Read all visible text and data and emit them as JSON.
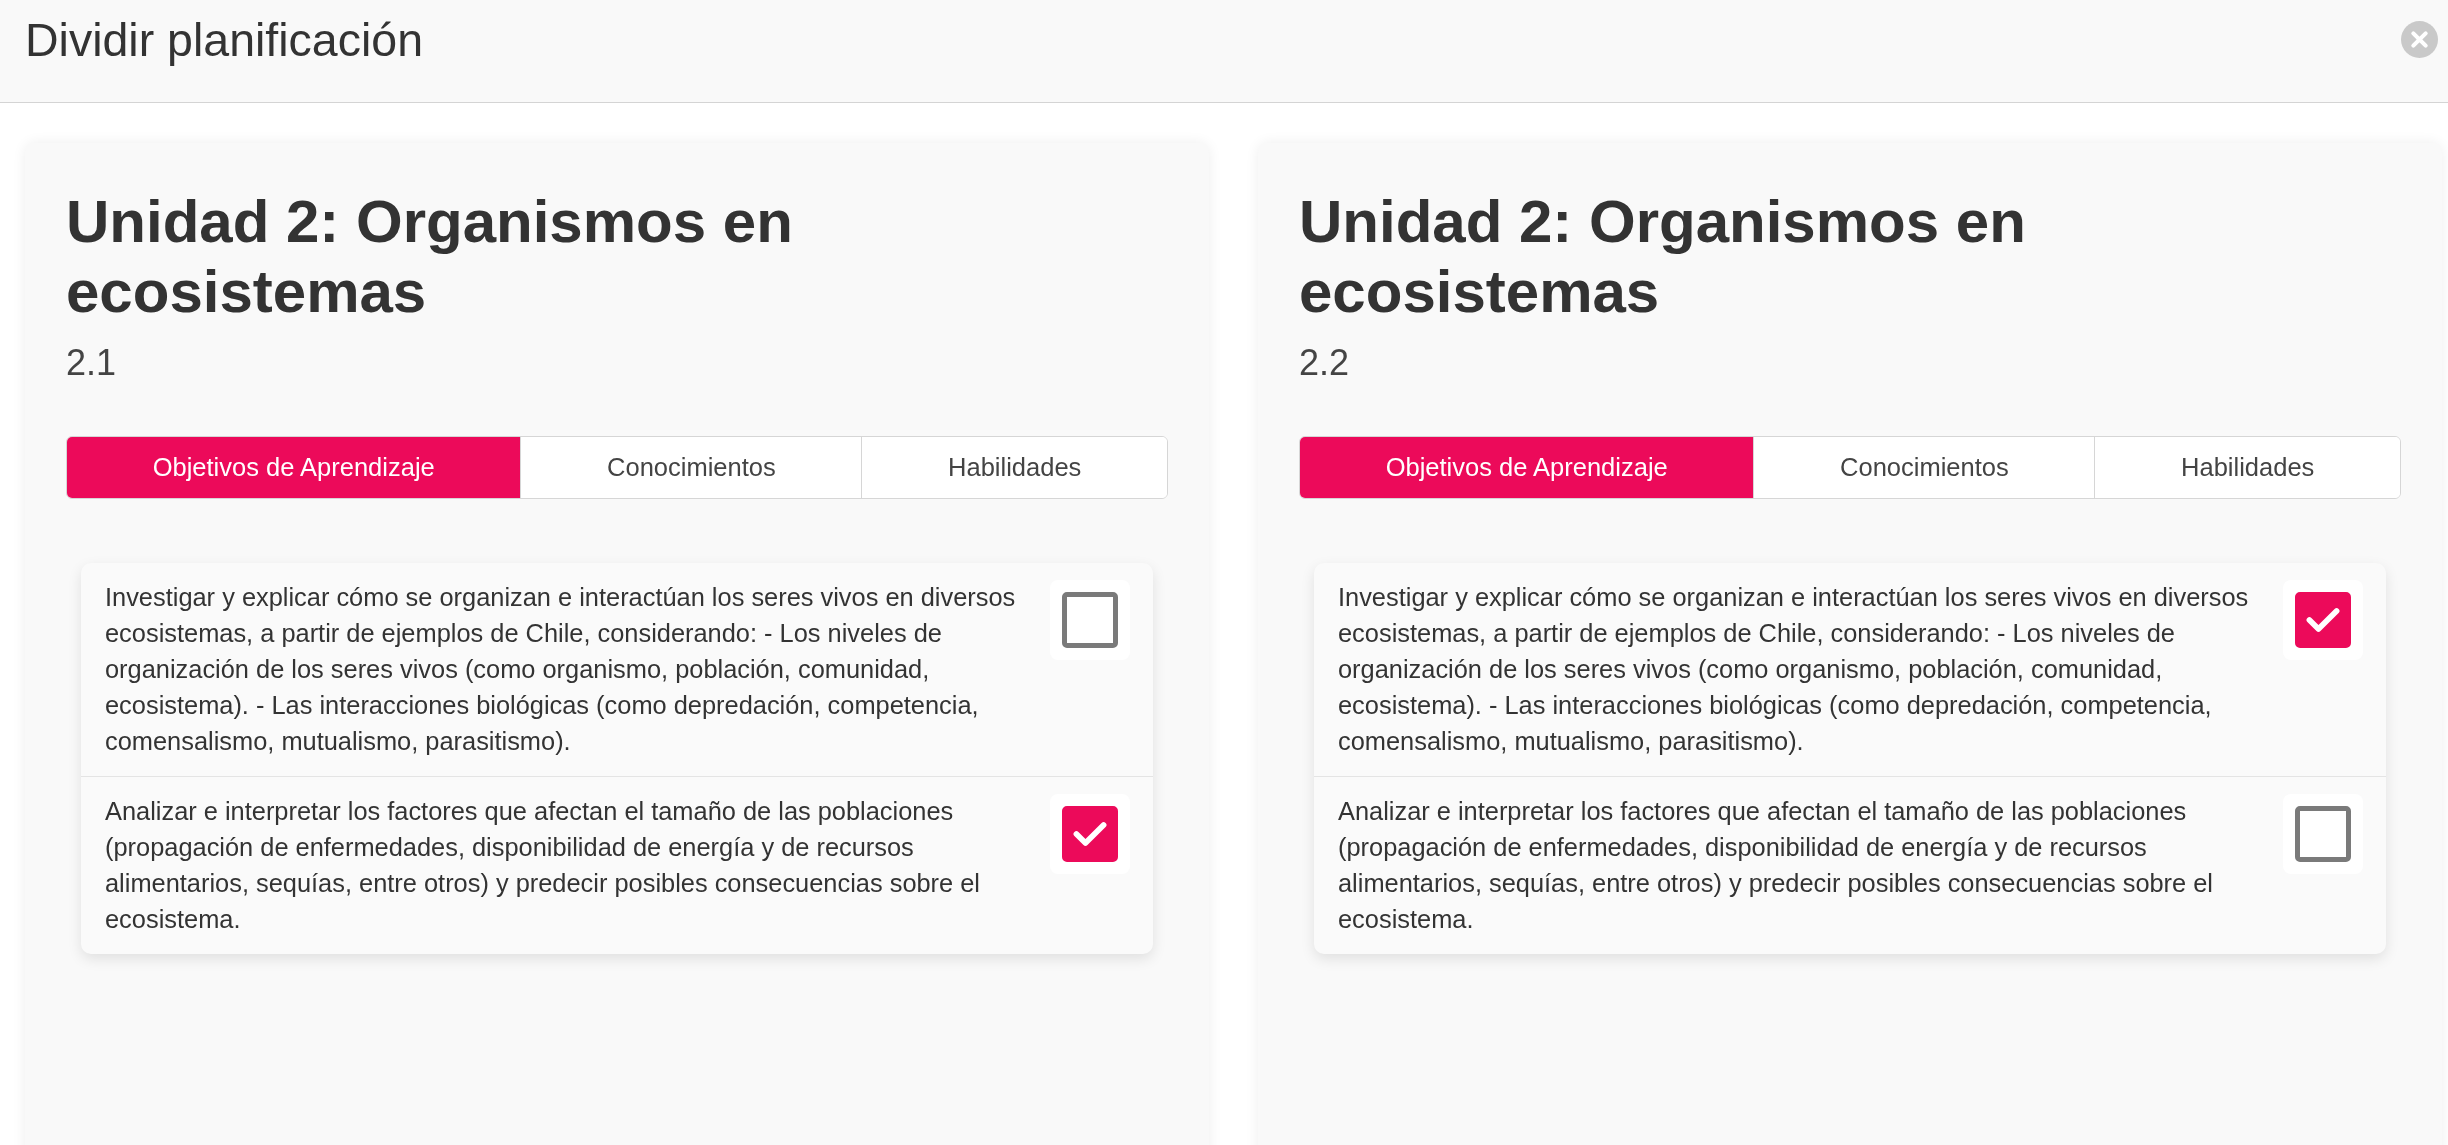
{
  "dialog": {
    "title": "Dividir planificación"
  },
  "panels": [
    {
      "title": "Unidad 2: Organismos en ecosistemas",
      "subtitle": "2.1",
      "tabs": [
        {
          "label": "Objetivos de Aprendizaje",
          "selected": true
        },
        {
          "label": "Conocimientos",
          "selected": false
        },
        {
          "label": "Habilidades",
          "selected": false
        }
      ],
      "objectives": [
        {
          "text": "Investigar y explicar cómo se organizan e interactúan los seres vivos en diversos ecosistemas, a partir de ejemplos de Chile, considerando: - Los niveles de organización de los seres vivos (como organismo, población, comunidad, ecosistema). - Las interacciones biológicas (como depredación, competencia, comensalismo, mutualismo, parasitismo).",
          "checked": false
        },
        {
          "text": "Analizar e interpretar los factores que afectan el tamaño de las poblaciones (propagación de enfermedades, disponibilidad de energía y de recursos alimentarios, sequías, entre otros) y predecir posibles consecuencias sobre el ecosistema.",
          "checked": true
        }
      ]
    },
    {
      "title": "Unidad 2: Organismos en ecosistemas",
      "subtitle": "2.2",
      "tabs": [
        {
          "label": "Objetivos de Aprendizaje",
          "selected": true
        },
        {
          "label": "Conocimientos",
          "selected": false
        },
        {
          "label": "Habilidades",
          "selected": false
        }
      ],
      "objectives": [
        {
          "text": "Investigar y explicar cómo se organizan e interactúan los seres vivos en diversos ecosistemas, a partir de ejemplos de Chile, considerando: - Los niveles de organización de los seres vivos (como organismo, población, comunidad, ecosistema). - Las interacciones biológicas (como depredación, competencia, comensalismo, mutualismo, parasitismo).",
          "checked": true
        },
        {
          "text": "Analizar e interpretar los factores que afectan el tamaño de las poblaciones (propagación de enfermedades, disponibilidad de energía y de recursos alimentarios, sequías, entre otros) y predecir posibles consecuencias sobre el ecosistema.",
          "checked": false
        }
      ]
    }
  ]
}
